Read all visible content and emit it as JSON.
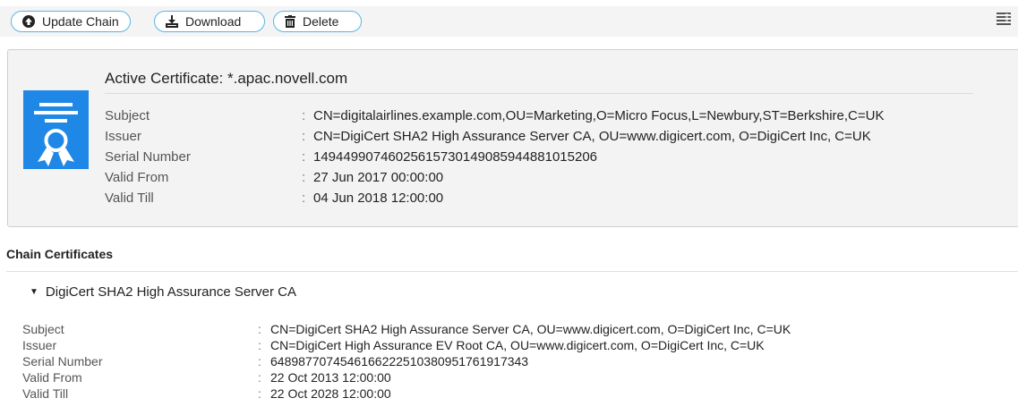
{
  "toolbar": {
    "update_label": "Update Chain",
    "download_label": "Download",
    "delete_label": "Delete"
  },
  "active": {
    "title": "Active Certificate: *.apac.novell.com",
    "fields": [
      {
        "label": "Subject",
        "value": "CN=digitalairlines.example.com,OU=Marketing,O=Micro Focus,L=Newbury,ST=Berkshire,C=UK"
      },
      {
        "label": "Issuer",
        "value": "CN=DigiCert SHA2 High Assurance Server CA, OU=www.digicert.com, O=DigiCert Inc, C=UK"
      },
      {
        "label": "Serial Number",
        "value": "14944990746025615730149085944881015206"
      },
      {
        "label": "Valid From",
        "value": "27 Jun 2017 00:00:00"
      },
      {
        "label": "Valid Till",
        "value": "04 Jun 2018 12:00:00"
      }
    ]
  },
  "chain": {
    "section_title": "Chain Certificates",
    "items": [
      {
        "name": "DigiCert SHA2 High Assurance Server CA",
        "fields": [
          {
            "label": "Subject",
            "value": "CN=DigiCert SHA2 High Assurance Server CA, OU=www.digicert.com, O=DigiCert Inc, C=UK"
          },
          {
            "label": "Issuer",
            "value": "CN=DigiCert High Assurance EV Root CA, OU=www.digicert.com, O=DigiCert Inc, C=UK"
          },
          {
            "label": "Serial Number",
            "value": "6489877074546166222510380951761917343"
          },
          {
            "label": "Valid From",
            "value": "22 Oct 2013 12:00:00"
          },
          {
            "label": "Valid Till",
            "value": "22 Oct 2028 12:00:00"
          }
        ]
      }
    ]
  },
  "colors": {
    "accent": "#1f87e5",
    "button_border": "#5ab4e6"
  },
  "icons": [
    "up-circle-icon",
    "download-icon",
    "trash-icon",
    "menu-icon",
    "certificate-icon",
    "caret-down-icon"
  ]
}
